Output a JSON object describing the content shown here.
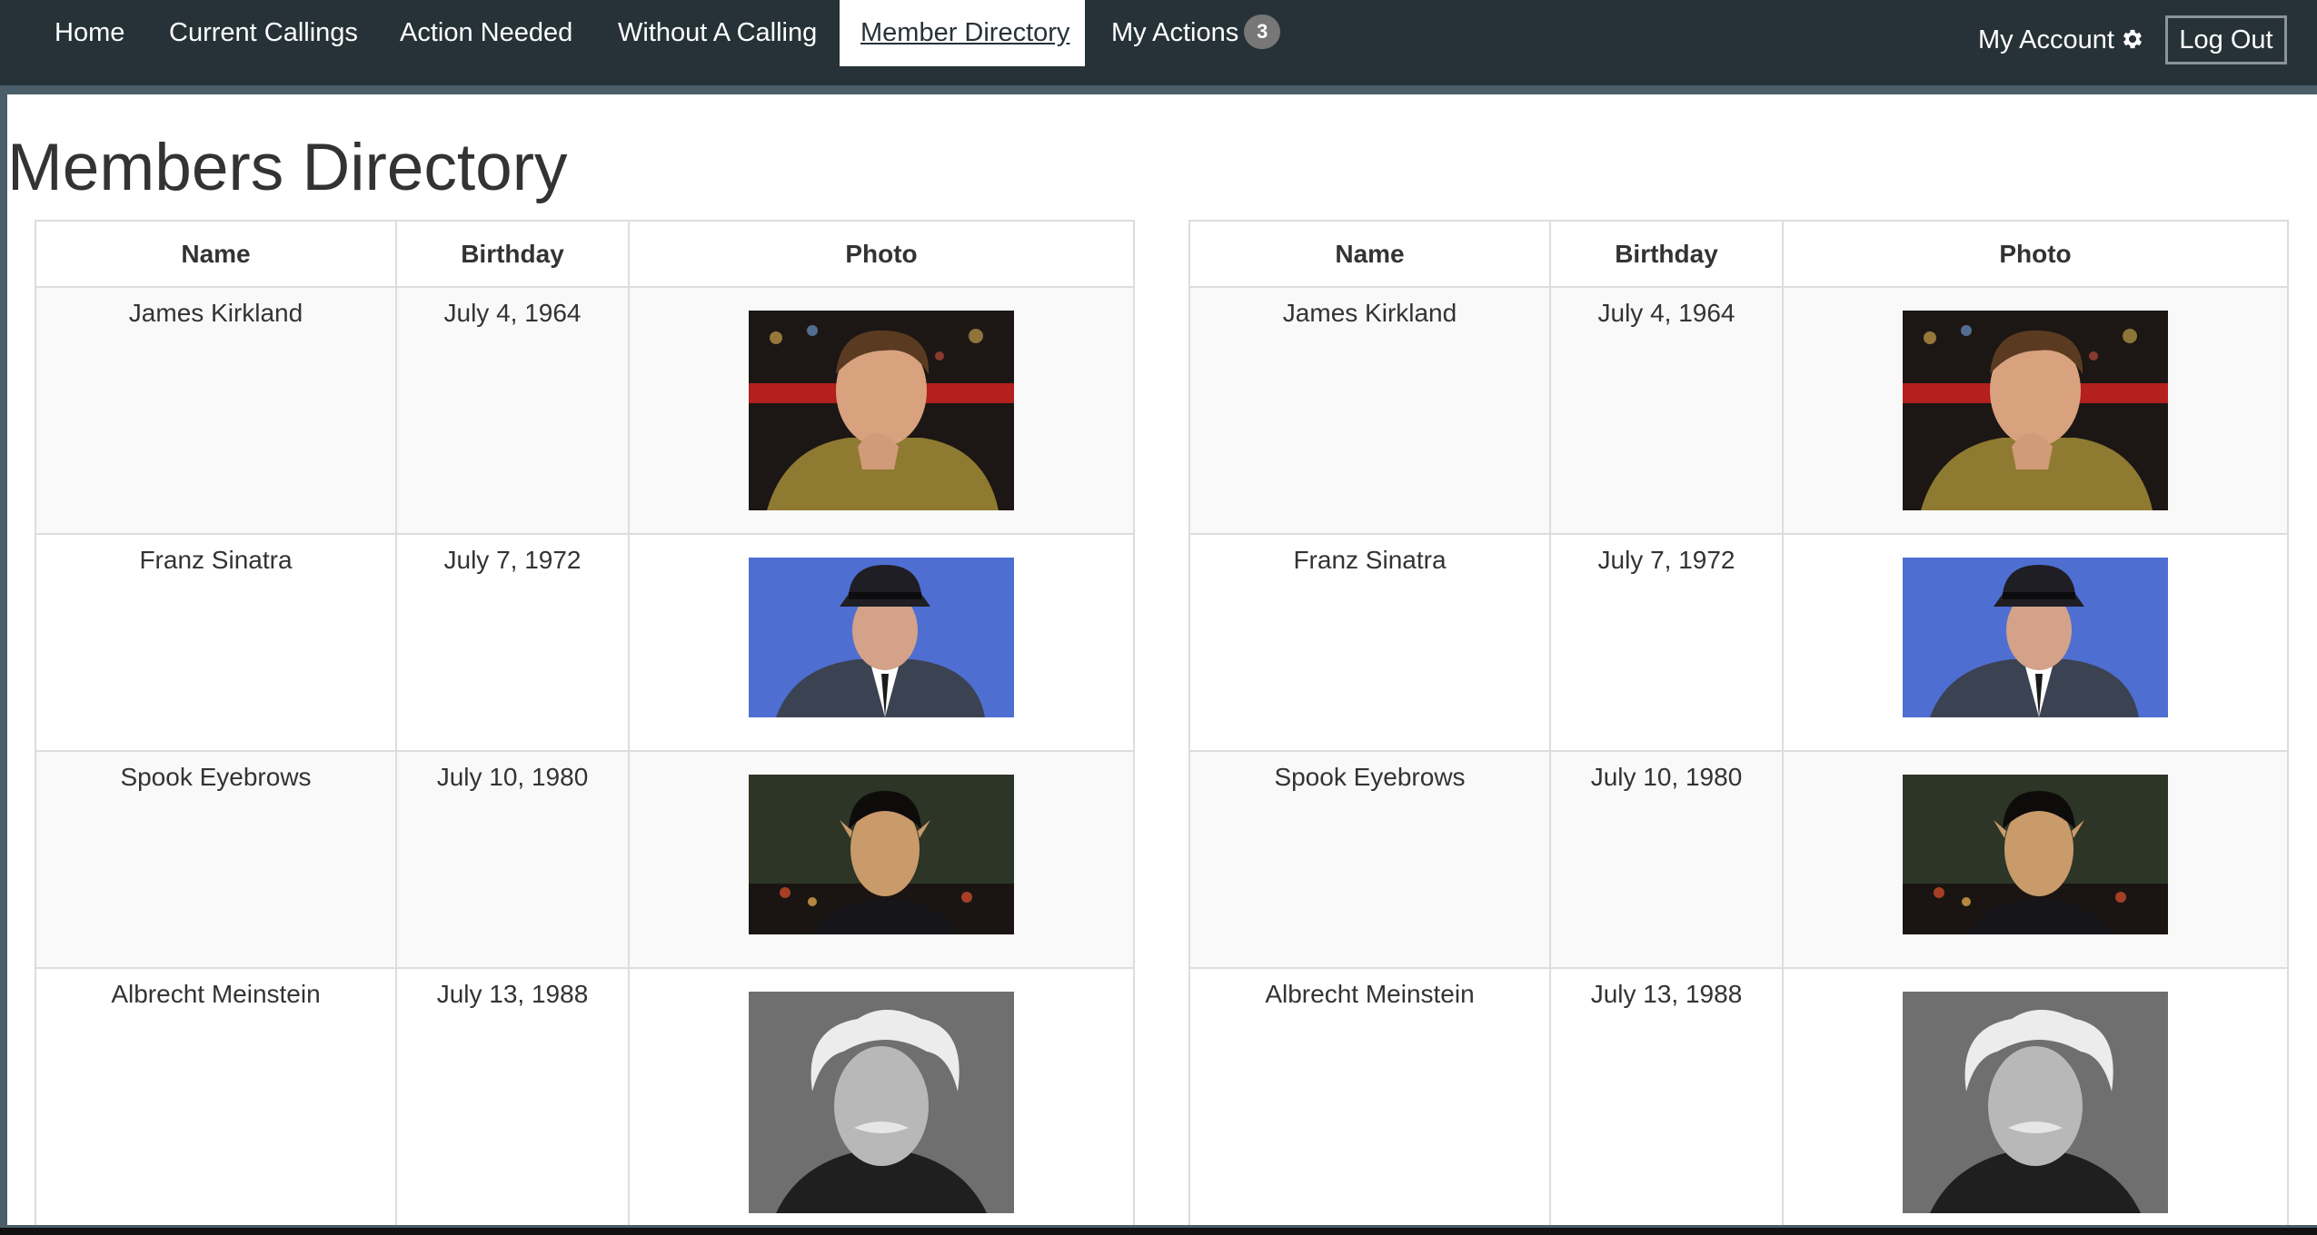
{
  "nav": {
    "items": [
      {
        "label": "Home",
        "active": false
      },
      {
        "label": "Current Callings",
        "active": false
      },
      {
        "label": "Action Needed",
        "active": false
      },
      {
        "label": "Without A Calling",
        "active": false
      },
      {
        "label": "Member Directory",
        "active": true
      },
      {
        "label": "My Actions",
        "active": false,
        "badge": "3"
      }
    ],
    "my_account": "My Account",
    "gear_icon": "gear-icon",
    "log_out": "Log Out"
  },
  "page": {
    "title": "Members Directory"
  },
  "directory": {
    "columns": [
      "Name",
      "Birthday",
      "Photo"
    ],
    "members": [
      {
        "name": "James Kirkland",
        "birthday": "July 4, 1964",
        "photo": "portrait-starship-captain"
      },
      {
        "name": "Franz Sinatra",
        "birthday": "July 7, 1972",
        "photo": "portrait-man-fedora"
      },
      {
        "name": "Spook Eyebrows",
        "birthday": "July 10, 1980",
        "photo": "portrait-pointed-ears"
      },
      {
        "name": "Albrecht Meinstein",
        "birthday": "July 13, 1988",
        "photo": "portrait-white-hair-mustache"
      }
    ]
  },
  "colors": {
    "nav_bg": "#263238",
    "page_bg": "#4a5d68",
    "badge_bg": "#777777",
    "row_stripe": "#f9f9f9",
    "border": "#dddddd"
  }
}
